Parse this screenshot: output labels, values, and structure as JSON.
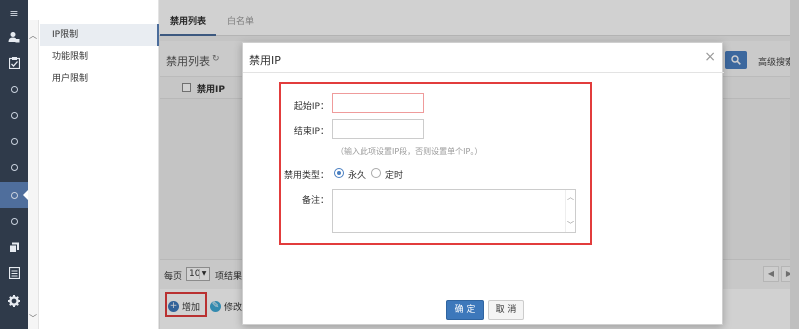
{
  "rail": {
    "menu_icon": "≡",
    "items": [
      "user-lock-icon",
      "clipboard-check-icon",
      "circle-icon",
      "circle-icon",
      "circle-icon",
      "circle-icon",
      "circle-icon",
      "circle-icon",
      "copy-icon",
      "list-icon",
      "gear-icon"
    ]
  },
  "submenu": {
    "items": [
      {
        "label": "IP限制",
        "active": true
      },
      {
        "label": "功能限制",
        "active": false
      },
      {
        "label": "用户限制",
        "active": false
      }
    ]
  },
  "tabs": [
    {
      "label": "禁用列表",
      "active": true
    },
    {
      "label": "白名单",
      "active": false
    }
  ],
  "panel": {
    "title": "禁用列表",
    "refresh_icon": "↻",
    "advanced_search": "高级搜索",
    "column_header": "禁用IP"
  },
  "pager": {
    "per_page_label": "每页",
    "per_page_value": "10",
    "items_label": "项结果"
  },
  "toolbar": {
    "add_label": "增加",
    "edit_label": "修改"
  },
  "modal": {
    "title": "禁用IP",
    "close": "×",
    "start_ip_label": "起始IP：",
    "end_ip_label": "结束IP：",
    "hint": "（输入此项设置IP段，否则设置单个IP。）",
    "type_label": "禁用类型：",
    "type_options": [
      {
        "label": "永久",
        "selected": true
      },
      {
        "label": "定时",
        "selected": false
      }
    ],
    "remark_label": "备注：",
    "ok_label": "确 定",
    "cancel_label": "取 消"
  },
  "colors": {
    "rail_bg": "#2f3a4a",
    "accent": "#4a7fc1",
    "highlight": "#e23c3c"
  }
}
